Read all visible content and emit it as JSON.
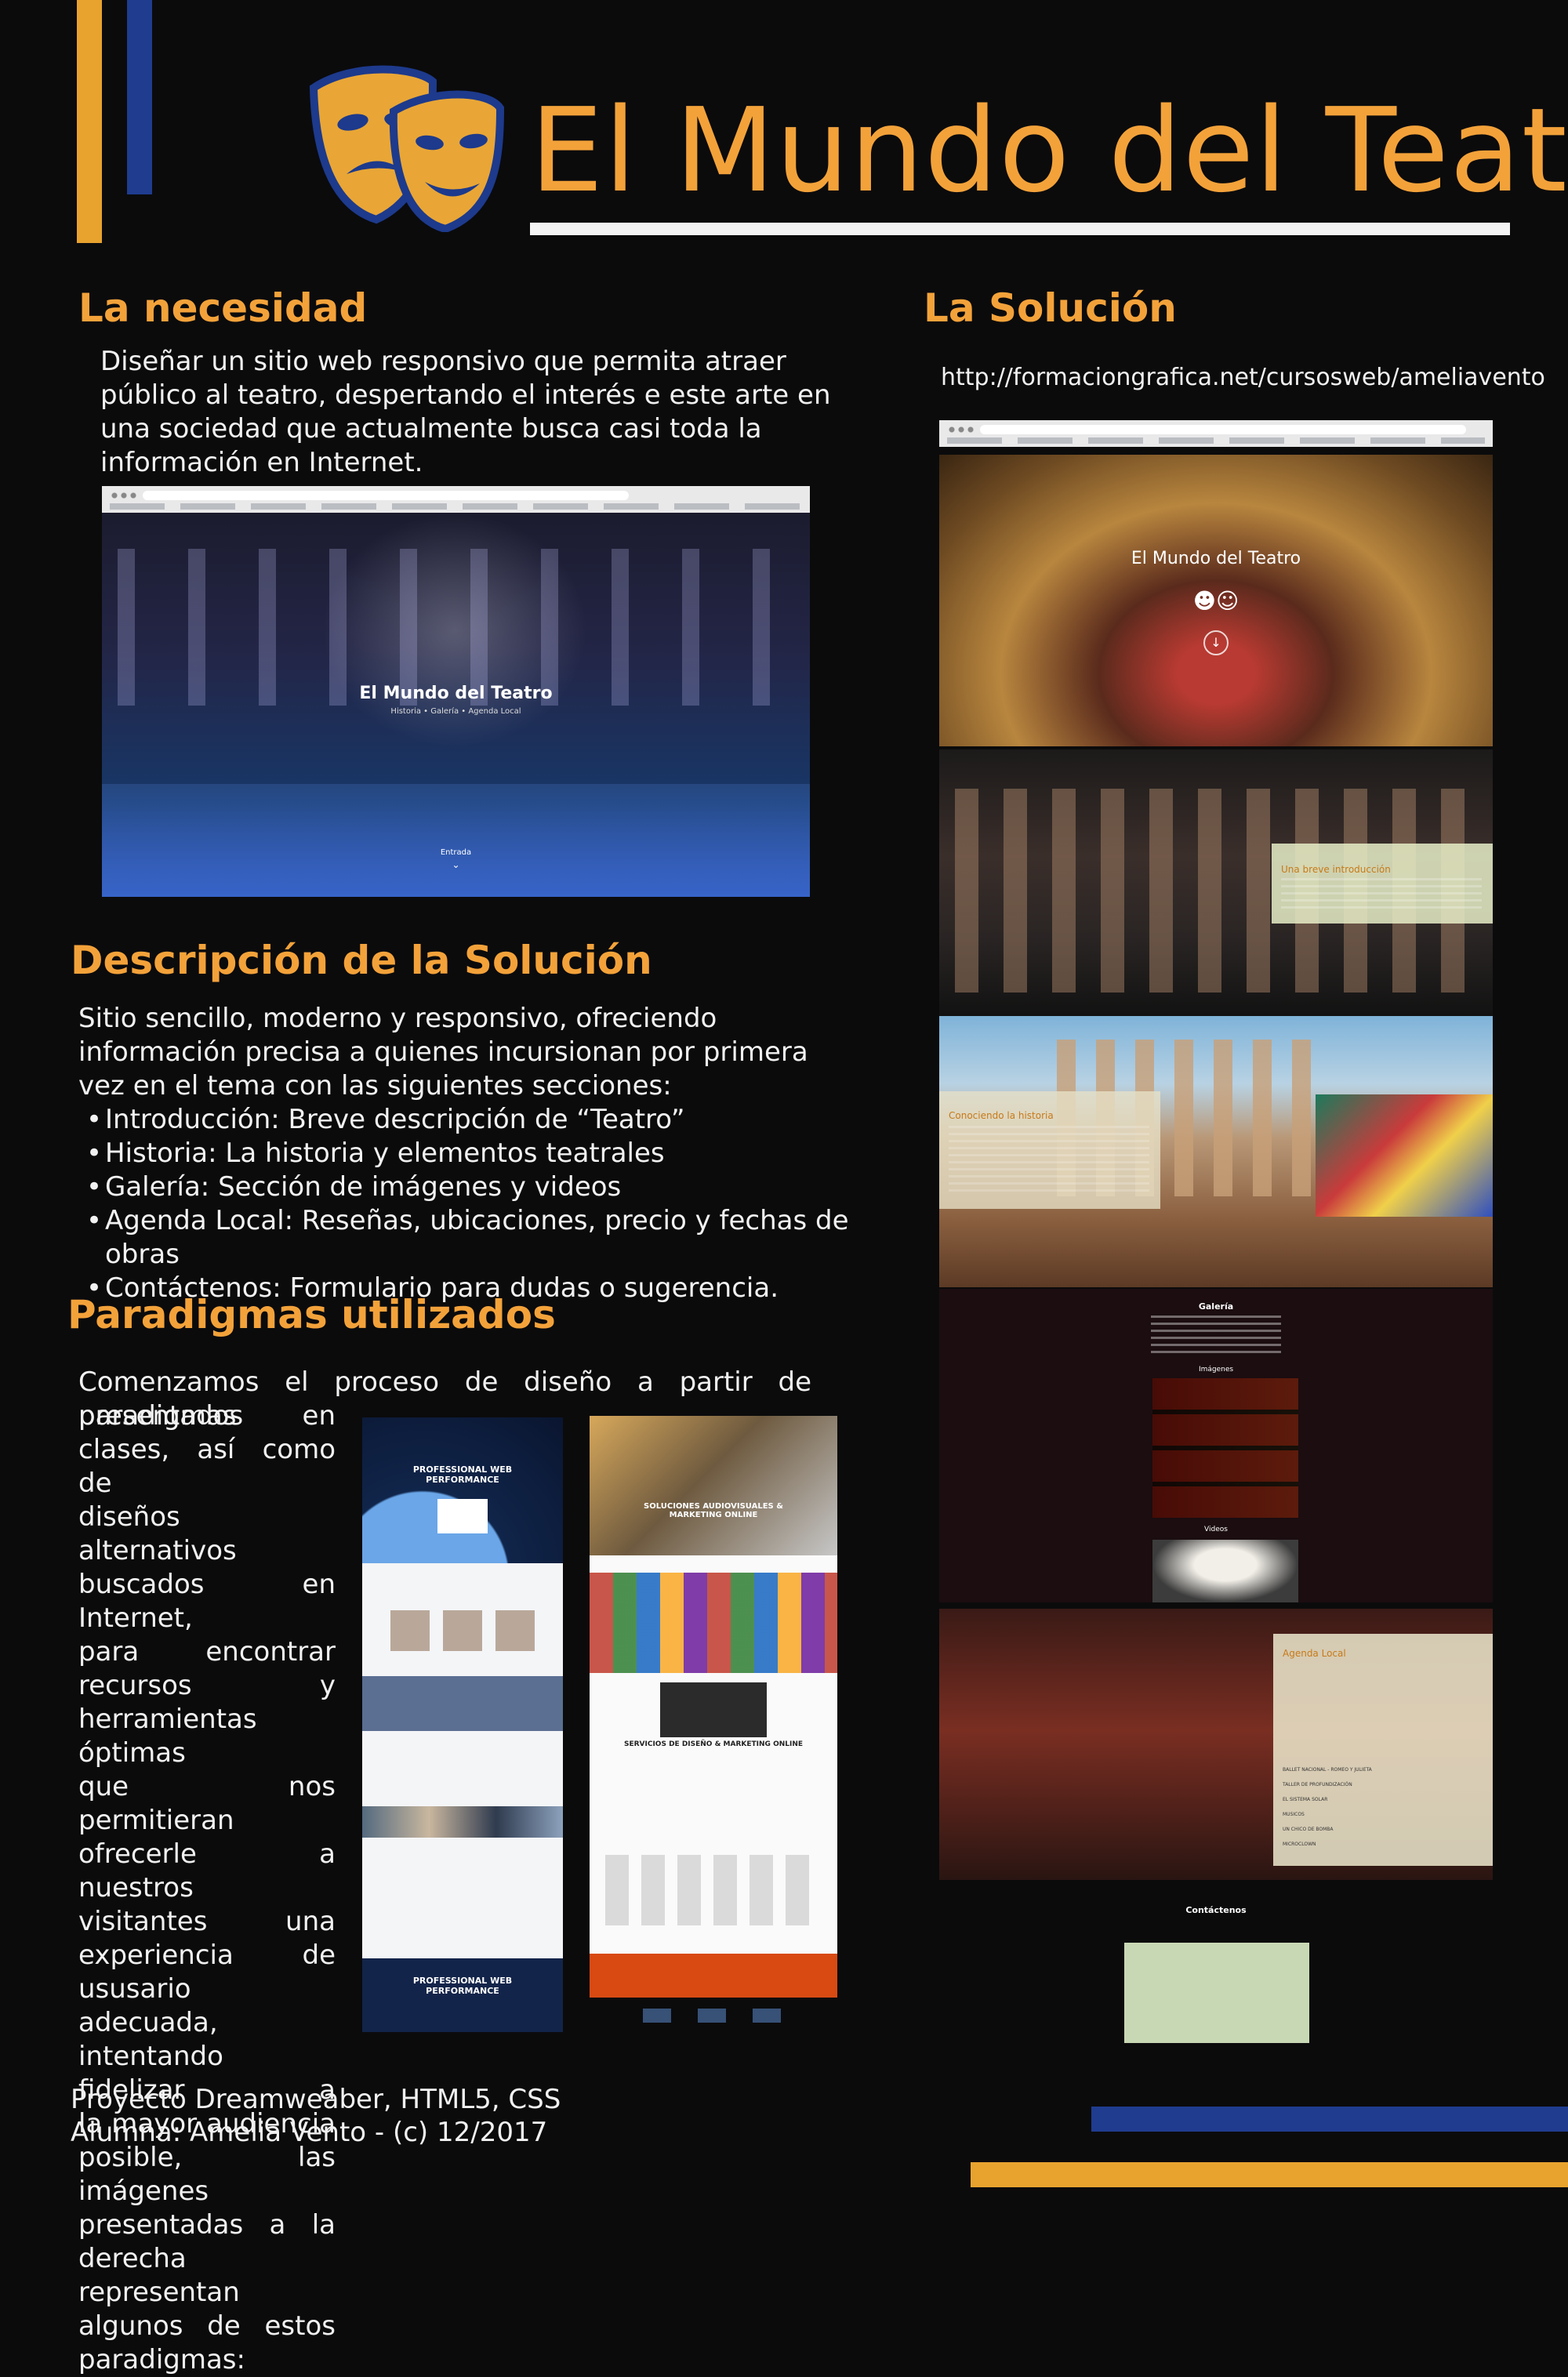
{
  "header": {
    "title": "El Mundo del Teatro"
  },
  "necesidad": {
    "heading": "La necesidad",
    "text": "Diseñar un sitio web responsivo que permita atraer público al teatro, despertando el interés e este arte en una sociedad que actualmente busca casi toda la información en Internet.",
    "screenshot": {
      "hero_title": "El Mundo del Teatro",
      "hero_nav": "Historia  •  Galería  •  Agenda Local",
      "hero_button": "Entrada"
    }
  },
  "descripcion": {
    "heading": "Descripción de la Solución",
    "intro": "Sitio sencillo, moderno y responsivo, ofreciendo información precisa a quienes incursionan por primera vez en el tema con las siguientes secciones:",
    "items": [
      "Introducción: Breve descripción de “Teatro”",
      "Historia: La historia y elementos teatrales",
      "Galería: Sección de imágenes y videos",
      "Agenda Local: Reseñas, ubicaciones, precio y fechas de obras",
      "Contáctenos: Formulario para dudas o sugerencia."
    ]
  },
  "paradigmas": {
    "heading": "Paradigmas utilizados",
    "first_line": "Comenzamos el proceso de diseño a partir de paradigmas",
    "lines": [
      "presentados en",
      "clases, así como de",
      "diseños alternativos",
      "buscados en Internet,",
      "para encontrar",
      "recursos y",
      "herramientas óptimas",
      "que nos permitieran",
      "ofrecerle a nuestros",
      "visitantes una",
      "experiencia de",
      "ususario adecuada,",
      "intentando fidelizar a",
      "la mayor audiencia",
      "posible, las imágenes",
      "presentadas a la",
      "derecha representan",
      "algunos de estos"
    ],
    "last_line": "paradigmas:",
    "paradigm1": {
      "hero": "PROFESSIONAL WEB PERFORMANCE",
      "footer": "PROFESSIONAL WEB PERFORMANCE"
    },
    "paradigm2": {
      "hero": "SOLUCIONES AUDIOVISUALES & MARKETING ONLINE",
      "services": "SERVICIOS DE DISEÑO & MARKETING ONLINE"
    }
  },
  "solucion": {
    "heading": "La Solución",
    "url": "http://formaciongrafica.net/cursosweb/ameliavento",
    "site": {
      "hero_title": "El Mundo del Teatro",
      "intro_heading": "Una breve introducción",
      "historia_heading": "Conociendo la historia",
      "galeria_heading": "Galería",
      "imagenes_label": "Imágenes",
      "videos_label": "Videos",
      "agenda_heading": "Agenda Local",
      "agenda_items": [
        "BALLET NACIONAL - ROMEO Y JULIETA",
        "TALLER DE PROFUNDIZACIÓN",
        "EL SISTEMA SOLAR",
        "MUSICOS",
        "UN CHICO DE BOMBA",
        "MICROCLOWN"
      ],
      "contact_heading": "Contáctenos"
    }
  },
  "footer": {
    "project": "Proyecto Dreamweaber, HTML5, CSS",
    "author": "Alumna: Amelia Vento - (c) 12/2017"
  },
  "colors": {
    "accent_orange": "#f3a23a",
    "accent_blue": "#1f3c8f",
    "background": "#0b0b0c"
  }
}
